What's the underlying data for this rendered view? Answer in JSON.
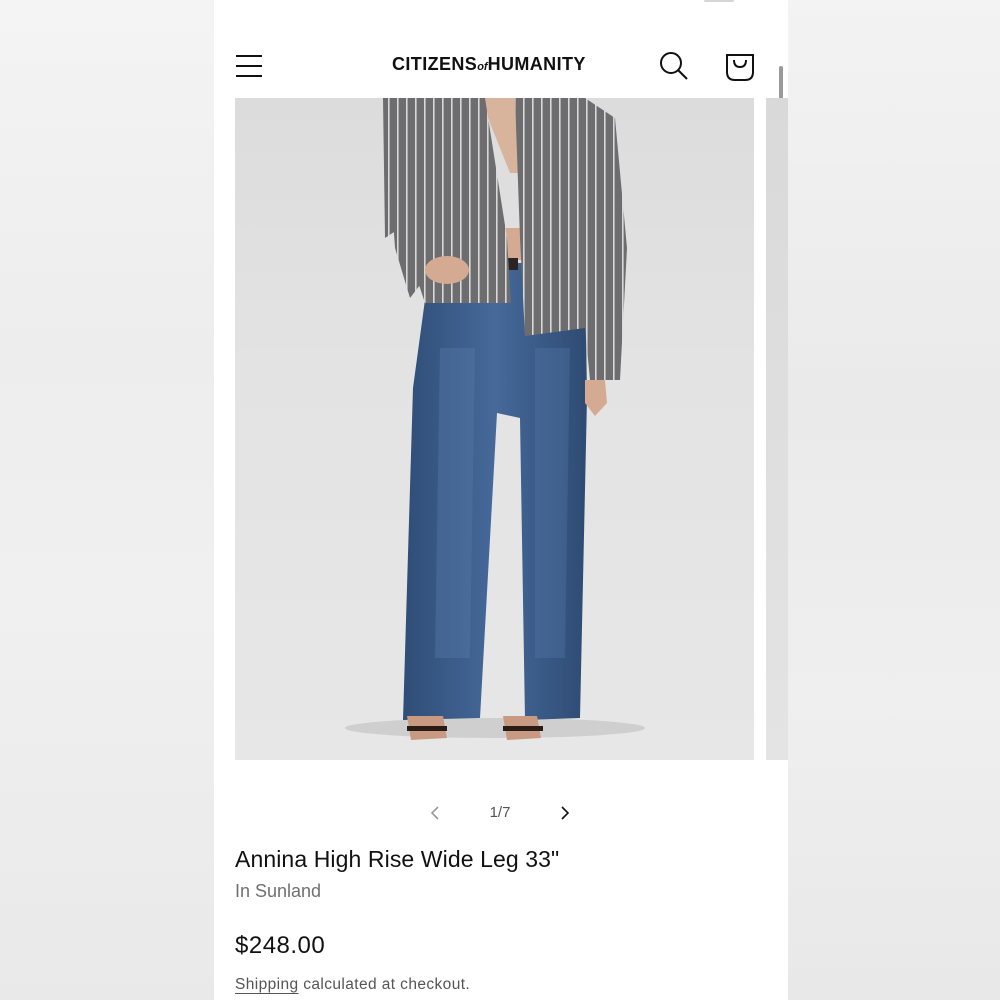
{
  "brand": {
    "name_part1": "CITIZENS",
    "name_connector": "of",
    "name_part2": "HUMANITY"
  },
  "header": {
    "menu_icon": "hamburger-menu-icon",
    "search_icon": "search-icon",
    "cart_icon": "shopping-bag-icon"
  },
  "gallery": {
    "image_subject": "model in grey striped shirt and medium-wash wide leg jeans",
    "pager_text": "1/7",
    "prev_icon": "chevron-left-icon",
    "next_icon": "chevron-right-icon"
  },
  "product": {
    "title": "Annina High Rise Wide Leg 33\"",
    "variant": "In Sunland",
    "price": "$248.00",
    "shipping_link": "Shipping",
    "shipping_note": "calculated at checkout."
  },
  "colors": {
    "text": "#111111",
    "muted": "#707070",
    "image_bg": "#e0e0e0",
    "denim": "#3d5f8a",
    "shirt": "#6f6f72"
  }
}
